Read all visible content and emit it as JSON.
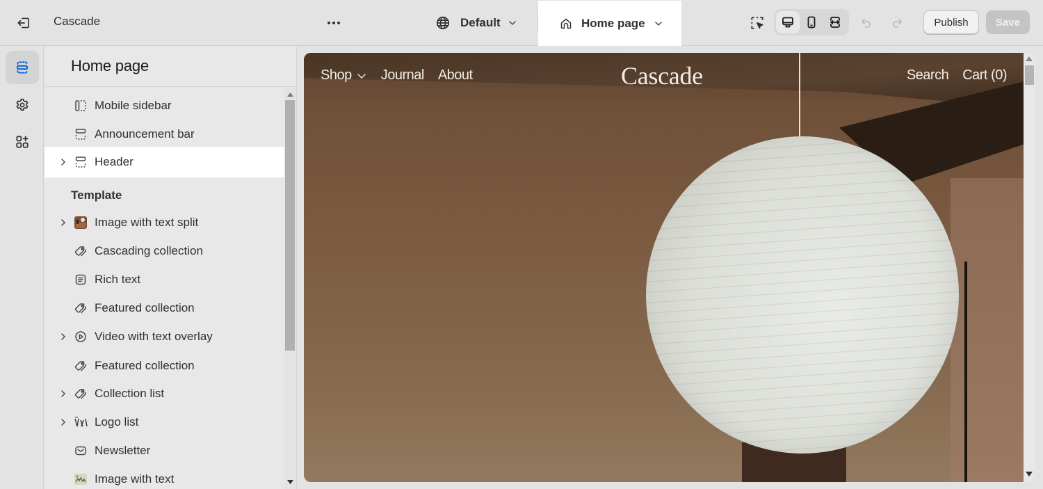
{
  "topbar": {
    "exit_icon": "exit-icon",
    "store_name": "Cascade",
    "more_icon": "more-horizontal-icon",
    "theme_selector": {
      "icon": "globe-icon",
      "label": "Default"
    },
    "page_selector": {
      "icon": "home-icon",
      "label": "Home page"
    },
    "inspector_icon": "inspector-icon",
    "device_modes": [
      {
        "name": "desktop",
        "icon": "desktop-icon",
        "active": true
      },
      {
        "name": "mobile",
        "icon": "mobile-icon",
        "active": false
      },
      {
        "name": "full-width",
        "icon": "full-width-icon",
        "active": false
      }
    ],
    "undo_icon": "undo-icon",
    "redo_icon": "redo-icon",
    "publish_label": "Publish",
    "save_label": "Save"
  },
  "rail": {
    "items": [
      {
        "name": "sections",
        "icon": "sections-icon",
        "active": true
      },
      {
        "name": "theme-settings",
        "icon": "gear-icon",
        "active": false
      },
      {
        "name": "apps",
        "icon": "apps-add-icon",
        "active": false
      }
    ]
  },
  "sidebar": {
    "title": "Home page",
    "header_group": [
      {
        "label": "Mobile sidebar",
        "icon": "sidebar-section-icon",
        "expandable": false,
        "selected": false
      },
      {
        "label": "Announcement bar",
        "icon": "header-section-icon",
        "expandable": false,
        "selected": false
      },
      {
        "label": "Header",
        "icon": "header-section-icon",
        "expandable": true,
        "selected": true
      }
    ],
    "template_label": "Template",
    "template_group": [
      {
        "label": "Image with text split",
        "icon": "image-thumbnail-icon",
        "expandable": true
      },
      {
        "label": "Cascading collection",
        "icon": "tag-icon",
        "expandable": false
      },
      {
        "label": "Rich text",
        "icon": "text-block-icon",
        "expandable": false
      },
      {
        "label": "Featured collection",
        "icon": "tag-icon",
        "expandable": false
      },
      {
        "label": "Video with text overlay",
        "icon": "play-circle-icon",
        "expandable": true
      },
      {
        "label": "Featured collection",
        "icon": "tag-icon",
        "expandable": false
      },
      {
        "label": "Collection list",
        "icon": "tag-icon",
        "expandable": true
      },
      {
        "label": "Logo list",
        "icon": "logo-thumbnail-icon",
        "expandable": true
      },
      {
        "label": "Newsletter",
        "icon": "envelope-icon",
        "expandable": false
      },
      {
        "label": "Image with text",
        "icon": "image-thumbnail-icon",
        "expandable": false
      }
    ]
  },
  "preview": {
    "nav_left": [
      "Shop",
      "Journal",
      "About"
    ],
    "logo": "Cascade",
    "nav_right": [
      "Search",
      "Cart (0)"
    ],
    "hero_image": "paper-lantern-photo"
  },
  "colors": {
    "accent_blue": "#005bd3",
    "chrome_bg": "#e3e3e3",
    "selected_row": "#ffffff",
    "save_disabled": "#c4c4c4"
  }
}
